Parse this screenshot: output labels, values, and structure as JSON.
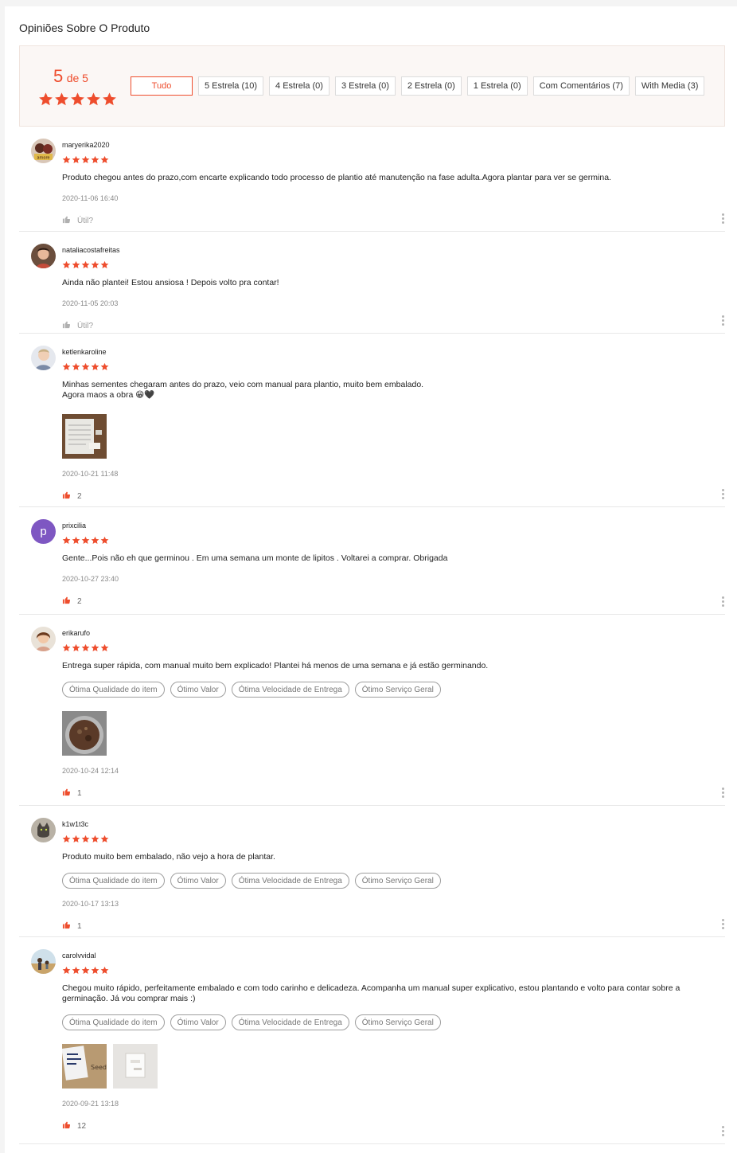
{
  "page_title": "Opiniões Sobre O Produto",
  "summary": {
    "score": "5",
    "of_text": "de 5",
    "filters": [
      "Tudo",
      "5 Estrela (10)",
      "4 Estrela (0)",
      "3 Estrela (0)",
      "2 Estrela (0)",
      "1 Estrela (0)",
      "Com Comentários (7)",
      "With Media (3)"
    ],
    "active_filter_index": 0
  },
  "accent_color": "#ee4d2d",
  "reviews": [
    {
      "username": "maryerika2020",
      "rating": 5,
      "comment": "Produto chegou antes do prazo,com encarte explicando todo processo de plantio até manutenção na fase adulta.Agora plantar para ver se germina.",
      "date": "2020-11-06 16:40",
      "like_text": "Útil?",
      "liked": false
    },
    {
      "username": "nataliacostafreitas",
      "rating": 5,
      "comment": "Ainda não plantei! Estou ansiosa ! Depois volto pra contar!",
      "date": "2020-11-05 20:03",
      "like_text": "Útil?",
      "liked": false
    },
    {
      "username": "ketlenkaroline",
      "rating": 5,
      "comment": "Minhas sementes chegaram antes do prazo, veio com manual para plantio, muito bem embalado.\nAgora maos a obra 😁🖤",
      "photo_count": 1,
      "date": "2020-10-21 11:48",
      "like_text": "2",
      "liked": true
    },
    {
      "username": "prixcilia",
      "avatar_letter": "p",
      "rating": 5,
      "comment": "Gente...Pois não eh que germinou . Em uma semana um monte de lipitos .  Voltarei a comprar. Obrigada",
      "date": "2020-10-27 23:40",
      "like_text": "2",
      "liked": true
    },
    {
      "username": "erikarufo",
      "rating": 5,
      "comment": "Entrega super rápida, com manual muito bem explicado! Plantei há menos de uma semana e já estão germinando.",
      "tags": [
        "Ótima Qualidade do item",
        "Ótimo Valor",
        "Ótima Velocidade de Entrega",
        "Ótimo Serviço Geral"
      ],
      "photo_count": 1,
      "date": "2020-10-24 12:14",
      "like_text": "1",
      "liked": true
    },
    {
      "username": "k1w1t3c",
      "rating": 5,
      "comment": "Produto muito bem embalado, não vejo a hora de plantar.",
      "tags": [
        "Ótima Qualidade do item",
        "Ótimo Valor",
        "Ótima Velocidade de Entrega",
        "Ótimo Serviço Geral"
      ],
      "date": "2020-10-17 13:13",
      "like_text": "1",
      "liked": true
    },
    {
      "username": "carolvvidal",
      "rating": 5,
      "comment": "Chegou muito rápido, perfeitamente embalado e com todo carinho e delicadeza. Acompanha um manual super explicativo, estou plantando e volto para contar sobre a germinação. Já vou comprar mais :)",
      "tags": [
        "Ótima Qualidade do item",
        "Ótimo Valor",
        "Ótima Velocidade de Entrega",
        "Ótimo Serviço Geral"
      ],
      "photo_count": 2,
      "date": "2020-09-21 13:18",
      "like_text": "12",
      "liked": true
    }
  ]
}
